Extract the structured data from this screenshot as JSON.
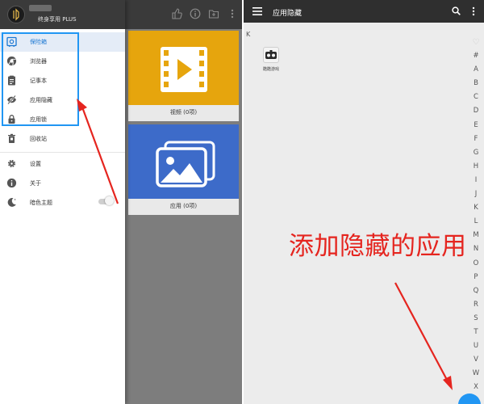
{
  "left_panel": {
    "drawer": {
      "title": "终身享用 PLUS",
      "items": [
        {
          "label": "保险箱",
          "icon": "safe-icon",
          "active": true
        },
        {
          "label": "浏览器",
          "icon": "browser-icon"
        },
        {
          "label": "记事本",
          "icon": "notepad-icon"
        },
        {
          "label": "应用隐藏",
          "icon": "eye-off-icon"
        },
        {
          "label": "应用锁",
          "icon": "lock-icon"
        },
        {
          "label": "回收站",
          "icon": "recycle-bin-icon"
        },
        {
          "label": "设置",
          "icon": "gear-icon"
        },
        {
          "label": "关于",
          "icon": "info-icon"
        },
        {
          "label": "暗色主题",
          "icon": "moon-icon"
        }
      ],
      "dark_theme_enabled": false
    },
    "tiles": [
      {
        "label": "视频 (0项)",
        "color": "#e6a50d",
        "icon": "video-icon"
      },
      {
        "label": "应用 (0项)",
        "color": "#3d6bc9",
        "icon": "photos-icon"
      }
    ]
  },
  "right_panel": {
    "title": "应用隐藏",
    "section_letter": "K",
    "apps": [
      {
        "name": "酷酷游戏",
        "icon": "vr-game-icon"
      }
    ],
    "index_letters": [
      "♡",
      "#",
      "A",
      "B",
      "C",
      "D",
      "E",
      "F",
      "G",
      "H",
      "I",
      "J",
      "K",
      "L",
      "M",
      "N",
      "O",
      "P",
      "Q",
      "R",
      "S",
      "T",
      "U",
      "V",
      "W",
      "X",
      "Y"
    ],
    "annotation": "添加隐藏的应用"
  },
  "colors": {
    "accent": "#2196f3",
    "annotation_red": "#e5251f",
    "topbar": "#2f2f2f"
  }
}
